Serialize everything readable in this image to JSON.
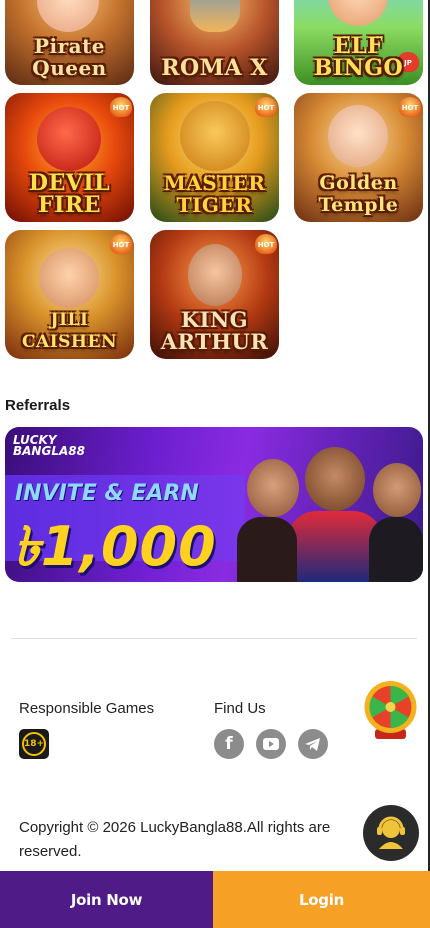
{
  "games": [
    {
      "title": "Pirate Queen",
      "hot": false
    },
    {
      "title": "ROMA X",
      "hot": false
    },
    {
      "title": "ELF BINGO",
      "hot": false,
      "badge": "JP"
    },
    {
      "title": "DEVIL FIRE",
      "hot": true
    },
    {
      "title": "MASTER TIGER",
      "hot": true
    },
    {
      "title": "Golden Temple",
      "hot": true
    },
    {
      "title": "JILI CAISHEN",
      "hot": true
    },
    {
      "title": "KING ARTHUR",
      "hot": true
    }
  ],
  "hot_label": "HOT",
  "referrals": {
    "title": "Referrals",
    "banner": {
      "logo_line1": "LUCKY",
      "logo_line2": "BANGLA88",
      "headline": "INVITE & EARN",
      "amount": "৳1,000"
    }
  },
  "footer": {
    "responsible_label": "Responsible Games",
    "age_badge": "18+",
    "find_us_label": "Find Us",
    "social_icons": [
      "facebook-icon",
      "youtube-icon",
      "telegram-icon"
    ],
    "copyright": "Copyright © 2026 LuckyBangla88.All rights are reserved."
  },
  "bottom_nav": {
    "join_label": "Join Now",
    "login_label": "Login"
  },
  "colors": {
    "join_bg": "#4e1b87",
    "login_bg": "#f6a126",
    "banner_purple": "#6d1fd0",
    "amount_yellow": "#ffd21f"
  }
}
